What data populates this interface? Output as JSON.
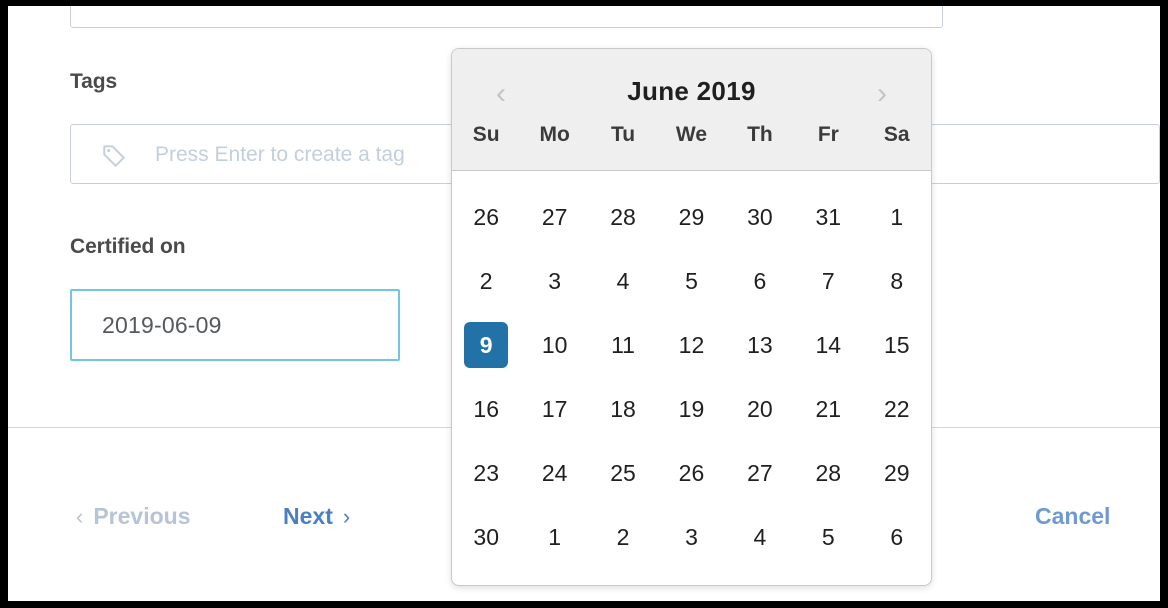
{
  "form": {
    "tags": {
      "label": "Tags",
      "icon": "tag-icon",
      "placeholder": "Press Enter to create a tag",
      "value": ""
    },
    "certified_on": {
      "label": "Certified on",
      "value": "2019-06-09",
      "focus_border_color": "#72c5e3"
    }
  },
  "footer": {
    "previous": {
      "label": "Previous",
      "chevron": "‹",
      "enabled": false
    },
    "next": {
      "label": "Next",
      "chevron": "›",
      "enabled": true
    },
    "cancel": {
      "label": "Cancel",
      "enabled": true
    }
  },
  "datepicker": {
    "title": "June 2019",
    "month": "June",
    "year": "2019",
    "prev_icon": "chevron-left-icon",
    "next_icon": "chevron-right-icon",
    "prev_glyph": "‹",
    "next_glyph": "›",
    "weekdays": [
      "Su",
      "Mo",
      "Tu",
      "We",
      "Th",
      "Fr",
      "Sa"
    ],
    "selected_day": 9,
    "selected_color": "#2272a8",
    "header_bg": "#efefef",
    "weeks": [
      [
        {
          "d": "26",
          "outside": true
        },
        {
          "d": "27",
          "outside": true
        },
        {
          "d": "28",
          "outside": true
        },
        {
          "d": "29",
          "outside": true
        },
        {
          "d": "30",
          "outside": true
        },
        {
          "d": "31",
          "outside": true
        },
        {
          "d": "1",
          "outside": false
        }
      ],
      [
        {
          "d": "2",
          "outside": false
        },
        {
          "d": "3",
          "outside": false
        },
        {
          "d": "4",
          "outside": false
        },
        {
          "d": "5",
          "outside": false
        },
        {
          "d": "6",
          "outside": false
        },
        {
          "d": "7",
          "outside": false
        },
        {
          "d": "8",
          "outside": false
        }
      ],
      [
        {
          "d": "9",
          "outside": false,
          "selected": true
        },
        {
          "d": "10",
          "outside": false
        },
        {
          "d": "11",
          "outside": false
        },
        {
          "d": "12",
          "outside": false
        },
        {
          "d": "13",
          "outside": false
        },
        {
          "d": "14",
          "outside": false
        },
        {
          "d": "15",
          "outside": false
        }
      ],
      [
        {
          "d": "16",
          "outside": false
        },
        {
          "d": "17",
          "outside": false
        },
        {
          "d": "18",
          "outside": false
        },
        {
          "d": "19",
          "outside": false
        },
        {
          "d": "20",
          "outside": false
        },
        {
          "d": "21",
          "outside": false
        },
        {
          "d": "22",
          "outside": false
        }
      ],
      [
        {
          "d": "23",
          "outside": false
        },
        {
          "d": "24",
          "outside": false
        },
        {
          "d": "25",
          "outside": false
        },
        {
          "d": "26",
          "outside": false
        },
        {
          "d": "27",
          "outside": false
        },
        {
          "d": "28",
          "outside": false
        },
        {
          "d": "29",
          "outside": false
        }
      ],
      [
        {
          "d": "30",
          "outside": false
        },
        {
          "d": "1",
          "outside": true
        },
        {
          "d": "2",
          "outside": true
        },
        {
          "d": "3",
          "outside": true
        },
        {
          "d": "4",
          "outside": true
        },
        {
          "d": "5",
          "outside": true
        },
        {
          "d": "6",
          "outside": true
        }
      ]
    ]
  }
}
